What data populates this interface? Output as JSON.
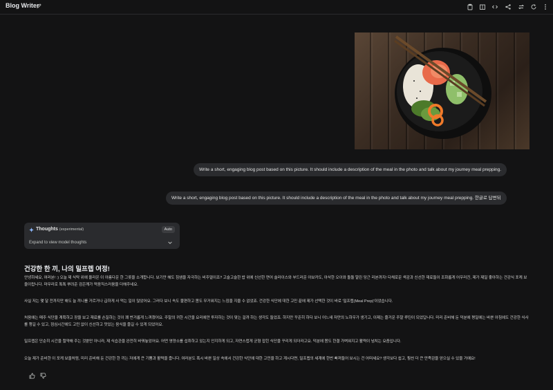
{
  "header": {
    "title": "Blog Writer",
    "icons": [
      "edit-icon",
      "clipboard-icon",
      "book-icon",
      "code-icon",
      "share-icon",
      "compare-icon",
      "refresh-icon",
      "more-icon"
    ]
  },
  "image": {
    "alt": "",
    "description": ""
  },
  "chat": {
    "prompt_1": "Write a short, engaging blog post based on this picture. It should include a description of the meal in the photo and talk about my journey meal prepping.",
    "prompt_2": "Write a short, engaging blog post based on this picture. It should include a description of the meal in the photo and talk about my journey meal prepping. 한글로 답변뒤"
  },
  "thoughts": {
    "title": "Thoughts",
    "experimental": "(experimental)",
    "auto": "Auto",
    "expand": "Expand to view model thoughts"
  },
  "post": {
    "title": "건강한 한 끼, 나의 밀프렙 여정!",
    "p1": "안녕하세요, 여러분! :) 오늘 제 식탁 위에 올라온 이 아름다운 한 그릇을 소개합니다. 보기만 해도 침샘을 자극하는 비주얼이죠? 고슬고슬한 밥 위에 신선한 연어 슬라이스와 부드러운 아보카도, 아삭한 오이와 돌돌 말린 당근 리본까지! 다채로운 색감과 신선한 재료들이 조화롭게 어우러진, 제가 제일 좋아하는 건강식 포케 보울이랍니다. 마무리로 톡톡 뿌려준 검은깨가 먹음직스러움을 더해주네요.",
    "p2": "사실 저는 몇 달 전까지만 해도 늘 끼니를 거르거나 급하게 사 먹는 일이 많았어요. 그러다 보니 속도 불편하고 몸도 무거워지는 느낌을 지울 수 없었죠. 건강한 식단에 대한 고민 끝에 제가 선택한 것이 바로 '밀프렙(Meal Prep)'이었습니다.",
    "p3": "처음에는 매주 식단을 계획하고 장을 보고 재료를 손질하는 것이 꽤 번거롭게 느껴졌어요. 주말의 귀한 시간을 요리에만 투자하는 것이 맞는 걸까 하는 생각도 들었죠. 하지만 꾸준히 하다 보니 어느새 저만의 노하우가 생기고, 이제는 즐거운 주말 루틴이 되었답니다. 미리 준비해 둔 덕분에 평일에는 바쁜 아침에도 건강한 식사를 챙길 수 있고, 점심시간에도 고민 없이 신선하고 맛있는 음식을 즐길 수 있게 되었어요.",
    "p4": "밀프렙은 단순히 시간을 절약해 주는 것뿐만 아니라, 제 식습관을 완전히 바꿔놓았어요. 어떤 영양소를 섭취하고 있는지 인지하게 되고, 자연스럽게 균형 잡힌 식단을 꾸리게 되더라고요. 덕분에 몸도 한결 가벼워지고 활력이 넘치는 요즘입니다.",
    "p5": "오늘 제가 준비한 이 포케 보울처럼, 미리 준비해 둔 건강한 한 끼는 저에게 큰 기쁨과 활력을 줍니다. 여러분도 혹시 바쁜 일상 속에서 건강한 식단에 대한 고민을 하고 계시다면, 밀프렙의 세계에 한번 빠져들어 보시는 건 어떠세요? 생각보다 쉽고, 훨씬 더 큰 만족감을 얻으실 수 있을 거예요!"
  },
  "feedback": [
    "thumbs-up-icon",
    "thumbs-down-icon"
  ],
  "colors": {
    "background": "#131314",
    "bubble": "#2a2b2e",
    "accent": "#8ab4f8"
  }
}
